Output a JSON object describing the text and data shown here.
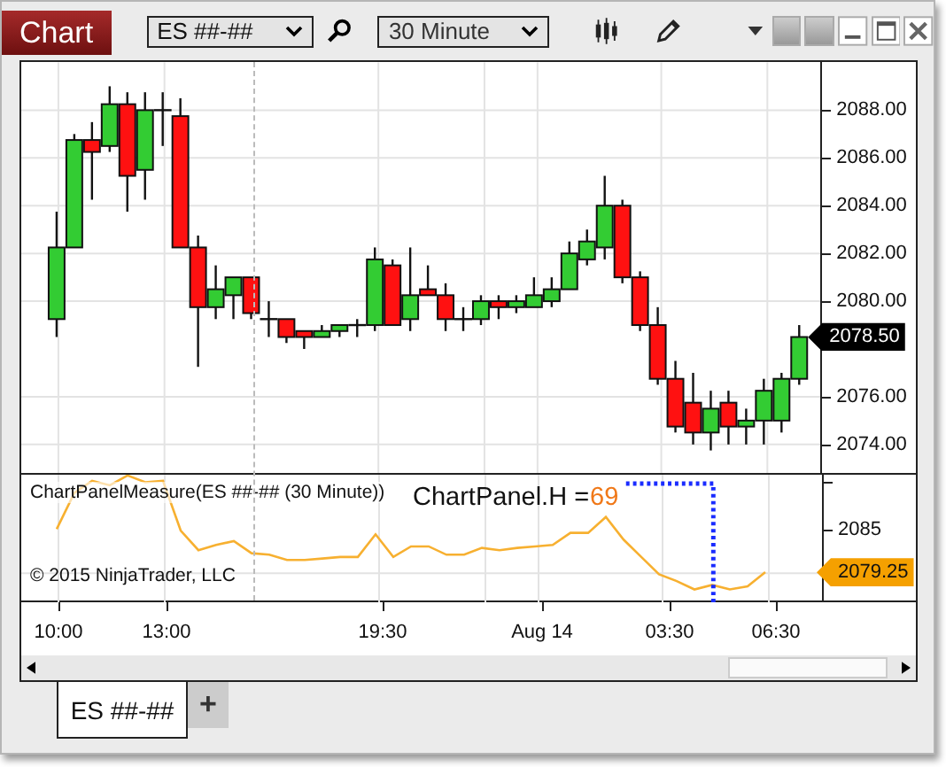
{
  "window": {
    "title": "Chart"
  },
  "toolbar": {
    "instrument": "ES ##-##",
    "interval": "30 Minute"
  },
  "price_chart": {
    "chart_data": {
      "type": "candlestick",
      "grid": true,
      "ylim": [
        2072.75,
        2090
      ],
      "yticks": [
        {
          "value": 2088,
          "label": "2088.00"
        },
        {
          "value": 2086,
          "label": "2086.00"
        },
        {
          "value": 2084,
          "label": "2084.00"
        },
        {
          "value": 2082,
          "label": "2082.00"
        },
        {
          "value": 2080,
          "label": "2080.00"
        },
        {
          "value": 2076,
          "label": "2076.00"
        },
        {
          "value": 2074,
          "label": "2074.00"
        }
      ],
      "ohlc": [
        [
          2079.25,
          2083.75,
          2078.5,
          2082.25
        ],
        [
          2082.25,
          2087,
          2082.25,
          2086.75
        ],
        [
          2086.75,
          2087.5,
          2084.25,
          2086.25
        ],
        [
          2086.5,
          2089,
          2086.25,
          2088.25
        ],
        [
          2088.25,
          2088.75,
          2083.75,
          2085.25
        ],
        [
          2085.5,
          2088.75,
          2084.25,
          2088
        ],
        [
          2088,
          2088.75,
          2086.5,
          2088
        ],
        [
          2087.75,
          2088.5,
          2082.25,
          2082.25
        ],
        [
          2082.25,
          2082.75,
          2077.25,
          2079.75
        ],
        [
          2079.75,
          2081.5,
          2079.25,
          2080.5
        ],
        [
          2080.25,
          2081,
          2079.25,
          2081
        ],
        [
          2081,
          2081,
          2079.25,
          2079.5
        ],
        [
          2079.25,
          2080,
          2078.5,
          2079.25
        ],
        [
          2079.25,
          2079.25,
          2078.25,
          2078.5
        ],
        [
          2078.75,
          2078.75,
          2078,
          2078.5
        ],
        [
          2078.5,
          2079,
          2078.5,
          2078.75
        ],
        [
          2078.75,
          2079,
          2078.5,
          2079
        ],
        [
          2079,
          2079.25,
          2078.5,
          2079
        ],
        [
          2079,
          2082.25,
          2078.75,
          2081.75
        ],
        [
          2081.5,
          2081.75,
          2079,
          2079
        ],
        [
          2079.25,
          2082.25,
          2078.75,
          2080.25
        ],
        [
          2080.5,
          2081.5,
          2080.25,
          2080.25
        ],
        [
          2080.25,
          2080.75,
          2078.75,
          2079.25
        ],
        [
          2079.25,
          2079.75,
          2078.75,
          2079.25
        ],
        [
          2079.25,
          2080.25,
          2079,
          2080
        ],
        [
          2080,
          2080.25,
          2079.25,
          2079.75
        ],
        [
          2079.75,
          2080.25,
          2079.5,
          2080
        ],
        [
          2079.75,
          2081,
          2079.75,
          2080.25
        ],
        [
          2080,
          2081,
          2079.75,
          2080.5
        ],
        [
          2080.5,
          2082.5,
          2080.5,
          2082
        ],
        [
          2081.75,
          2083,
          2081.5,
          2082.5
        ],
        [
          2082.25,
          2085.25,
          2081.75,
          2084
        ],
        [
          2084,
          2084.25,
          2080.75,
          2081
        ],
        [
          2081,
          2081.25,
          2078.75,
          2079
        ],
        [
          2079,
          2079.75,
          2076.5,
          2076.75
        ],
        [
          2076.75,
          2077.5,
          2074.5,
          2074.75
        ],
        [
          2075.75,
          2077,
          2074,
          2074.5
        ],
        [
          2074.5,
          2076.25,
          2073.75,
          2075.5
        ],
        [
          2075.75,
          2076.25,
          2074,
          2074.75
        ],
        [
          2074.75,
          2075.5,
          2074,
          2075
        ],
        [
          2075,
          2076.75,
          2074,
          2076.25
        ],
        [
          2075,
          2077,
          2074.5,
          2076.75
        ],
        [
          2076.75,
          2079,
          2076.5,
          2078.5
        ]
      ]
    },
    "last_price": "2078.50"
  },
  "indicator": {
    "label": "ChartPanelMeasure(ES ##-## (30 Minute))",
    "measure_label": "ChartPanel.H =",
    "measure_value": "69",
    "copyright": "© 2015 NinjaTrader, LLC",
    "chart_data": {
      "type": "line",
      "grid": true,
      "ylim": [
        2075.3,
        2092.2
      ],
      "yticks": [
        {
          "value": 2085,
          "label": "2085"
        },
        {
          "value": 2079.25,
          "label": "2079.25"
        }
      ],
      "series": [
        {
          "color": "#f7b030",
          "values": [
            2085,
            2089.8,
            2091.4,
            2090.8,
            2092.1,
            2091.2,
            2091.4,
            2084.8,
            2082.2,
            2082.9,
            2083.4,
            2081.8,
            2081.6,
            2080.9,
            2080.9,
            2081.1,
            2081.3,
            2081.3,
            2084.3,
            2081.3,
            2082.7,
            2082.7,
            2081.6,
            2081.6,
            2082.5,
            2082.2,
            2082.5,
            2082.7,
            2082.9,
            2084.5,
            2084.5,
            2086.6,
            2083.6,
            2081.3,
            2079,
            2078.1,
            2077,
            2077.6,
            2077,
            2077.4,
            2079.3
          ]
        }
      ]
    }
  },
  "time_axis": [
    "10:00",
    "13:00",
    "19:30",
    "Aug 14",
    "03:30",
    "06:30"
  ],
  "tabs": [
    {
      "label": "ES ##-##",
      "selected": true
    },
    {
      "label": "+",
      "selected": false
    }
  ]
}
